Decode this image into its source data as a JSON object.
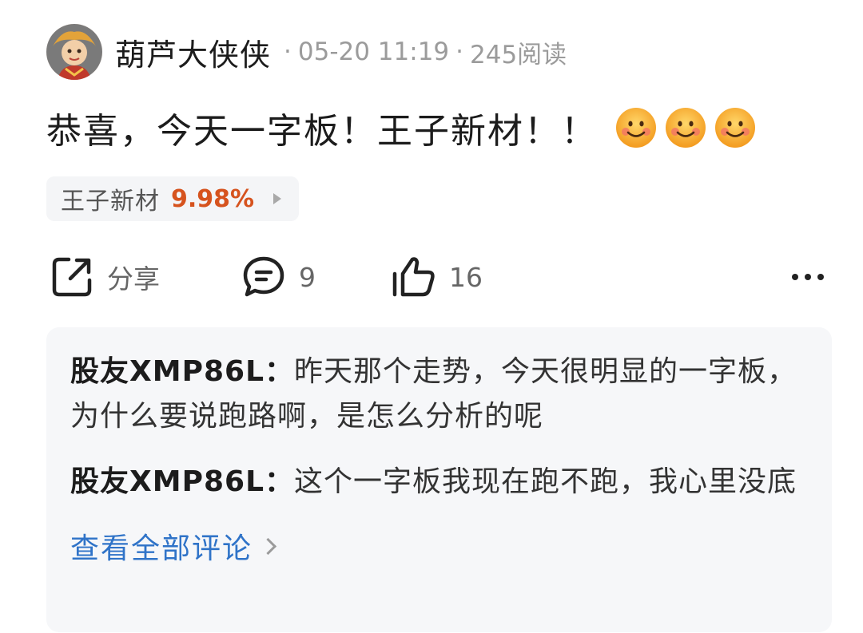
{
  "header": {
    "author": "葫芦大侠侠",
    "timestamp": "05-20 11:19",
    "reads": "245阅读",
    "separator": "·"
  },
  "post": {
    "text": "恭喜，今天一字板！王子新材！！",
    "emojis": [
      "smile-emoji",
      "smile-emoji",
      "smile-emoji"
    ]
  },
  "stock": {
    "name": "王子新材",
    "change": "9.98%",
    "change_color": "#d6531e"
  },
  "actions": {
    "share_label": "分享",
    "comment_count": "9",
    "like_count": "16",
    "more_icon": "more-dots-icon"
  },
  "comments": [
    {
      "user": "股友XMP86L",
      "separator": "：",
      "text": "昨天那个走势，今天很明显的一字板，为什么要说跑路啊，是怎么分析的呢"
    },
    {
      "user": "股友XMP86L",
      "separator": "：",
      "text": "这个一字板我现在跑不跑，我心里没底"
    }
  ],
  "view_all_label": "查看全部评论",
  "colors": {
    "link": "#2f73c8",
    "gain": "#d6531e",
    "muted": "#9b9b9b"
  }
}
